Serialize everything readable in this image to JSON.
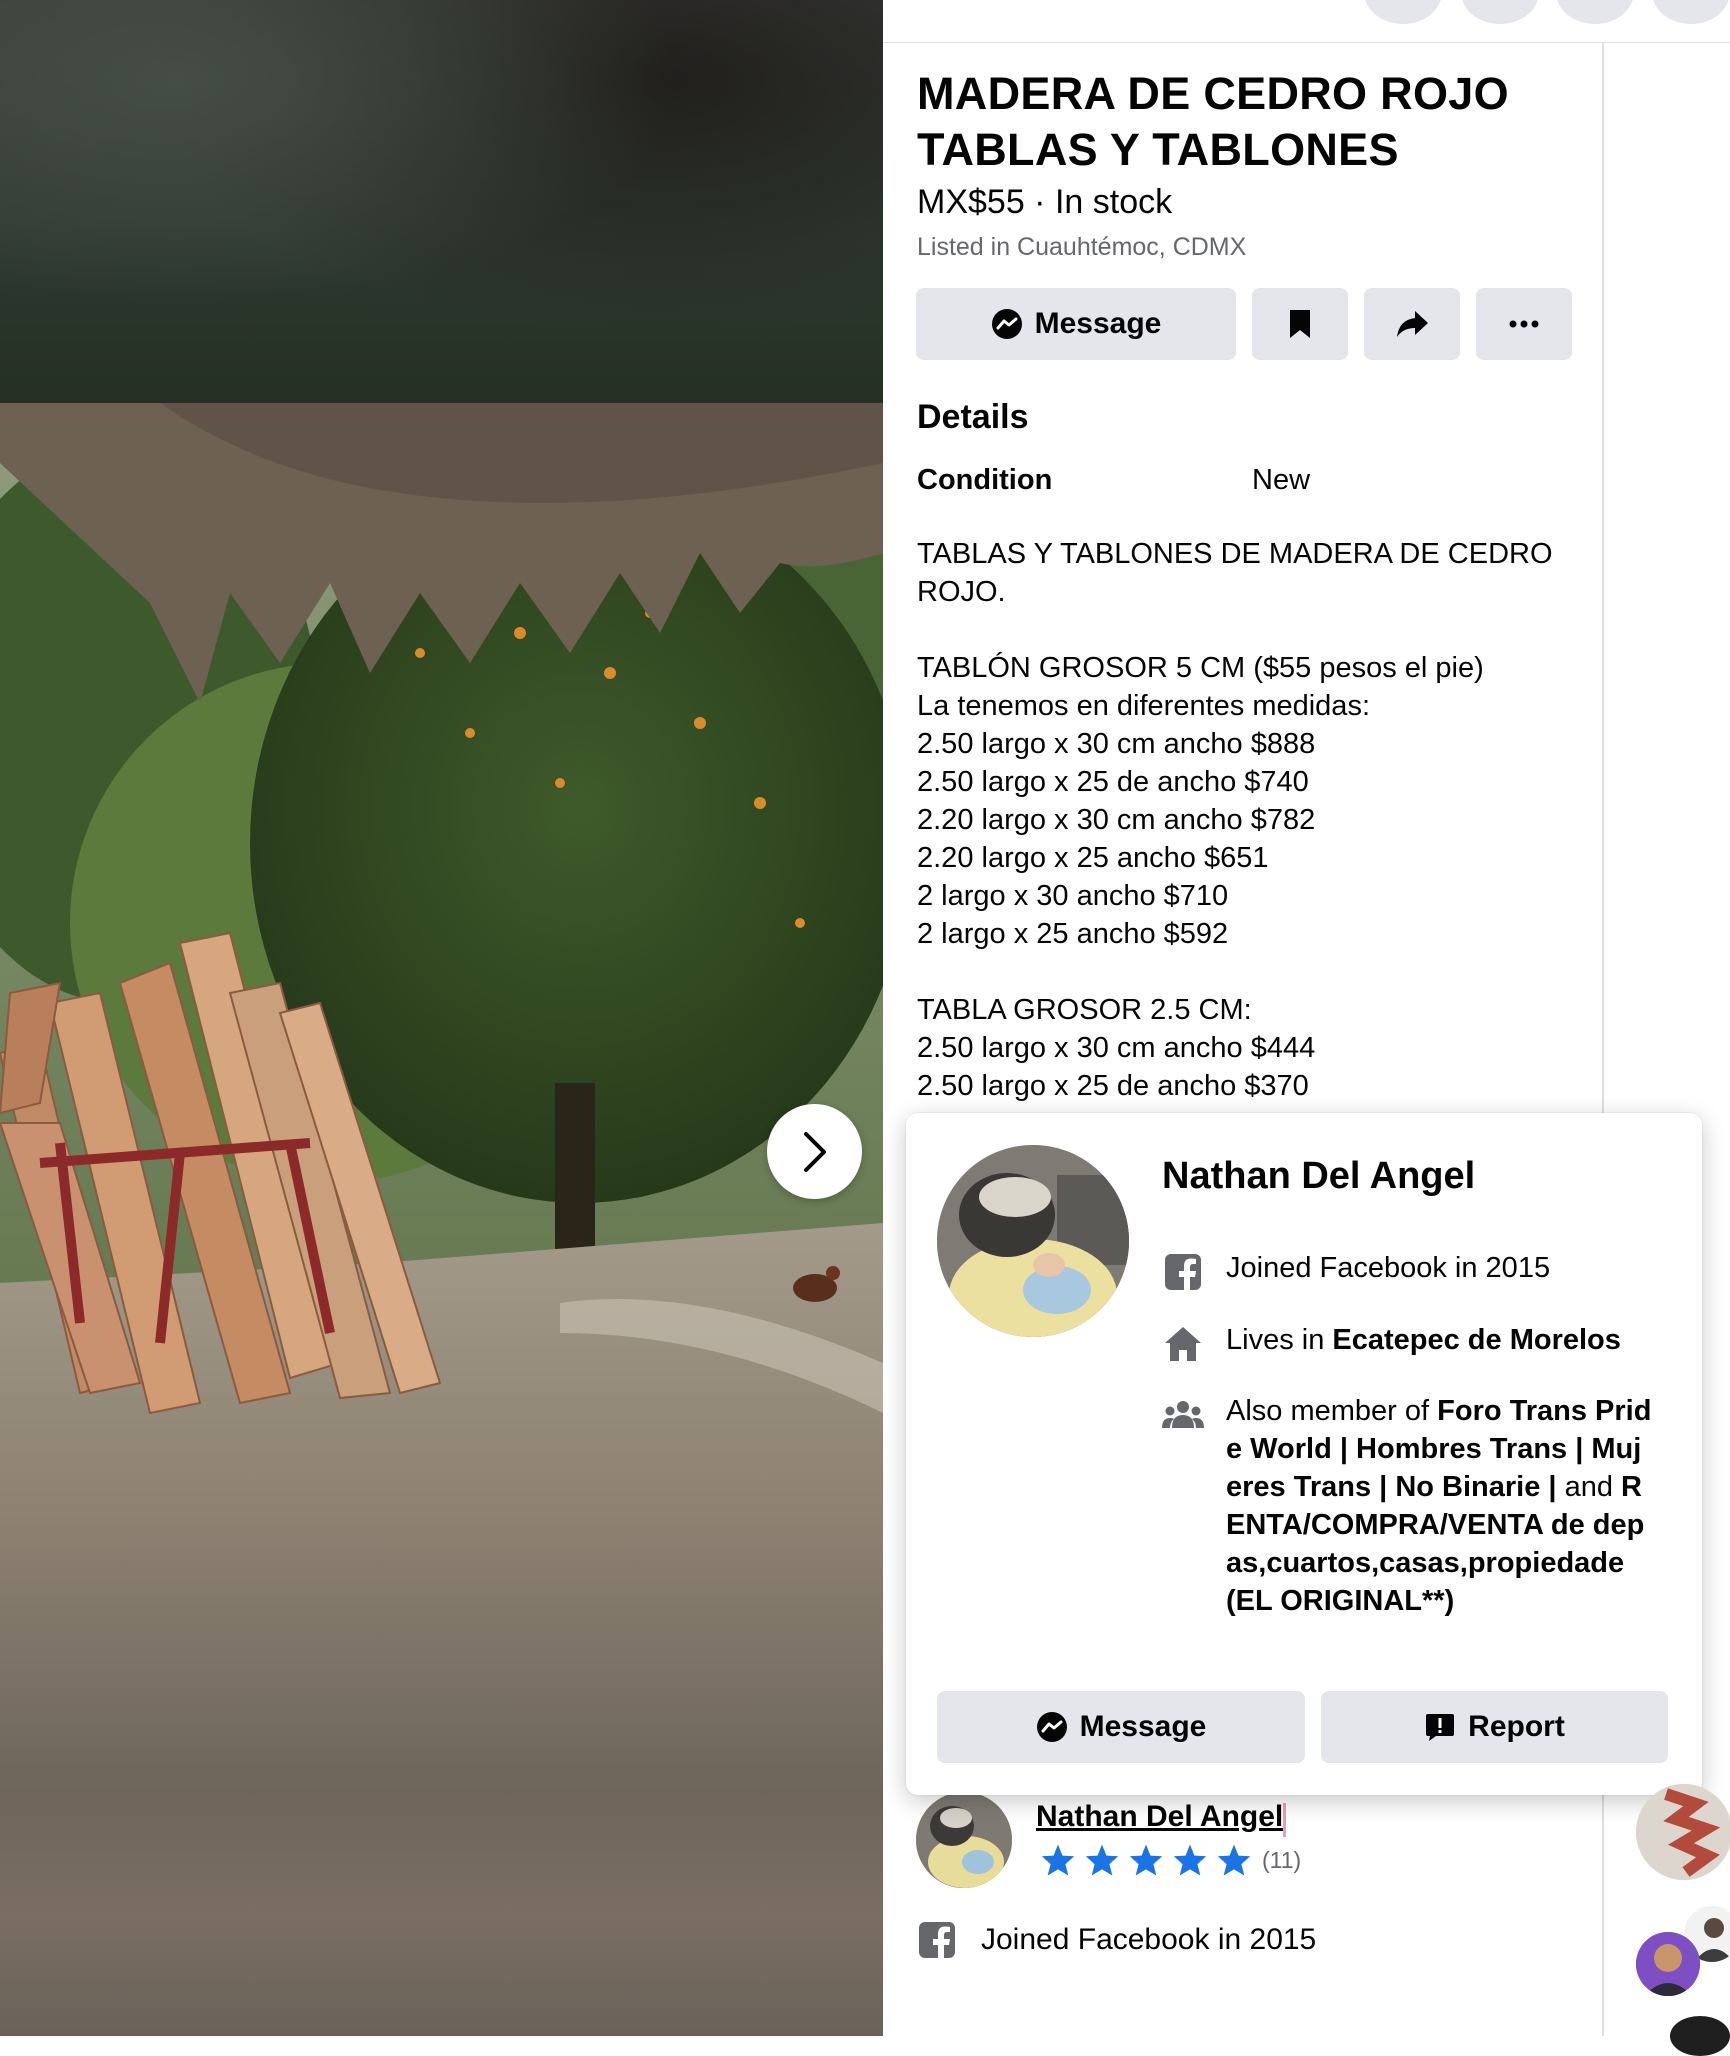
{
  "listing": {
    "title": "MADERA DE CEDRO ROJO TABLAS Y TABLONES",
    "price_stock": "MX$55 · In stock",
    "location": "Listed in Cuauhtémoc, CDMX"
  },
  "actions": {
    "message_label": "Message",
    "save_icon": "bookmark-icon",
    "share_icon": "share-arrow-icon",
    "more_icon": "more-dots-icon"
  },
  "details": {
    "heading": "Details",
    "condition_label": "Condition",
    "condition_value": "New",
    "description_lines": [
      "TABLAS Y TABLONES DE MADERA DE CEDRO",
      "ROJO.",
      "",
      "TABLÓN GROSOR 5 CM ($55 pesos el pie)",
      "La tenemos en diferentes medidas:",
      "2.50 largo x 30 cm ancho $888",
      "2.50 largo x 25 de ancho $740",
      "2.20 largo x 30 cm ancho $782",
      "2.20 largo x 25 ancho $651",
      "2 largo x 30 ancho $710",
      "2 largo x 25 ancho $592",
      "",
      "TABLA GROSOR 2.5 CM:",
      "2.50 largo x 30 cm ancho $444",
      "2.50 largo x 25 de ancho $370"
    ]
  },
  "profile_card": {
    "name": "Nathan Del Angel",
    "joined": "Joined Facebook in 2015",
    "lives_prefix": "Lives in ",
    "lives_place": "Ecatepec de Morelos",
    "member_prefix": "Also member of ",
    "member_group1": "Foro Trans Pride World | Hombres Trans | Mujeres Trans | No Binarie |",
    "member_and": " and ",
    "member_group2": "RENTA/COMPRA/VENTA de depas,cuartos,casas,propiedade (EL ORIGINAL**)",
    "message_label": "Message",
    "report_label": "Report"
  },
  "seller": {
    "name": "Nathan Del Angel",
    "rating_stars": 5,
    "rating_count": "(11)",
    "joined": "Joined Facebook in 2015"
  },
  "colors": {
    "button_bg": "#e4e6eb",
    "star": "#1b74e4",
    "secondary_text": "#65676b"
  }
}
